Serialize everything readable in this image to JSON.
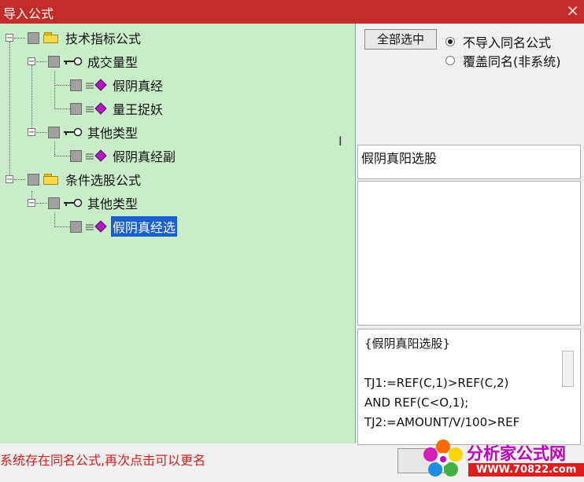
{
  "window": {
    "title": "导入公式",
    "close_icon": "close-icon"
  },
  "tree": {
    "nodes": [
      {
        "label": "技术指标公式",
        "type": "folder",
        "expanded": true
      },
      {
        "label": "成交量型",
        "type": "group",
        "expanded": true
      },
      {
        "label": "假阴真经",
        "type": "formula"
      },
      {
        "label": "量王捉妖",
        "type": "formula"
      },
      {
        "label": "其他类型",
        "type": "group",
        "expanded": true
      },
      {
        "label": "假阴真经副",
        "type": "formula"
      },
      {
        "label": "条件选股公式",
        "type": "folder",
        "expanded": true
      },
      {
        "label": "其他类型",
        "type": "group",
        "expanded": true
      },
      {
        "label": "假阴真经选",
        "type": "formula",
        "selected": true
      }
    ],
    "expander_symbol": "−"
  },
  "controls": {
    "select_all_label": "全部选中",
    "radio_skip_label": "不导入同名公式",
    "radio_overwrite_label": "覆盖同名(非系统)",
    "radio_selected": "skip"
  },
  "detail": {
    "name": "假阴真阳选股",
    "code_lines": [
      "{假阴真阳选股}",
      "",
      "TJ1:=REF(C,1)>REF(C,2)",
      "AND REF(C<O,1);",
      "TJ2:=AMOUNT/V/100>REF"
    ]
  },
  "status": {
    "message": "系统存在同名公式,再次点击可以更名"
  },
  "logo": {
    "name": "分析家公式网",
    "url": "WWW.70822.com"
  },
  "colors": {
    "titlebar": "#c42b2b",
    "tree_bg": "#c9ecc9",
    "selection": "#1a5fd0",
    "status_text": "#d21f1f"
  }
}
